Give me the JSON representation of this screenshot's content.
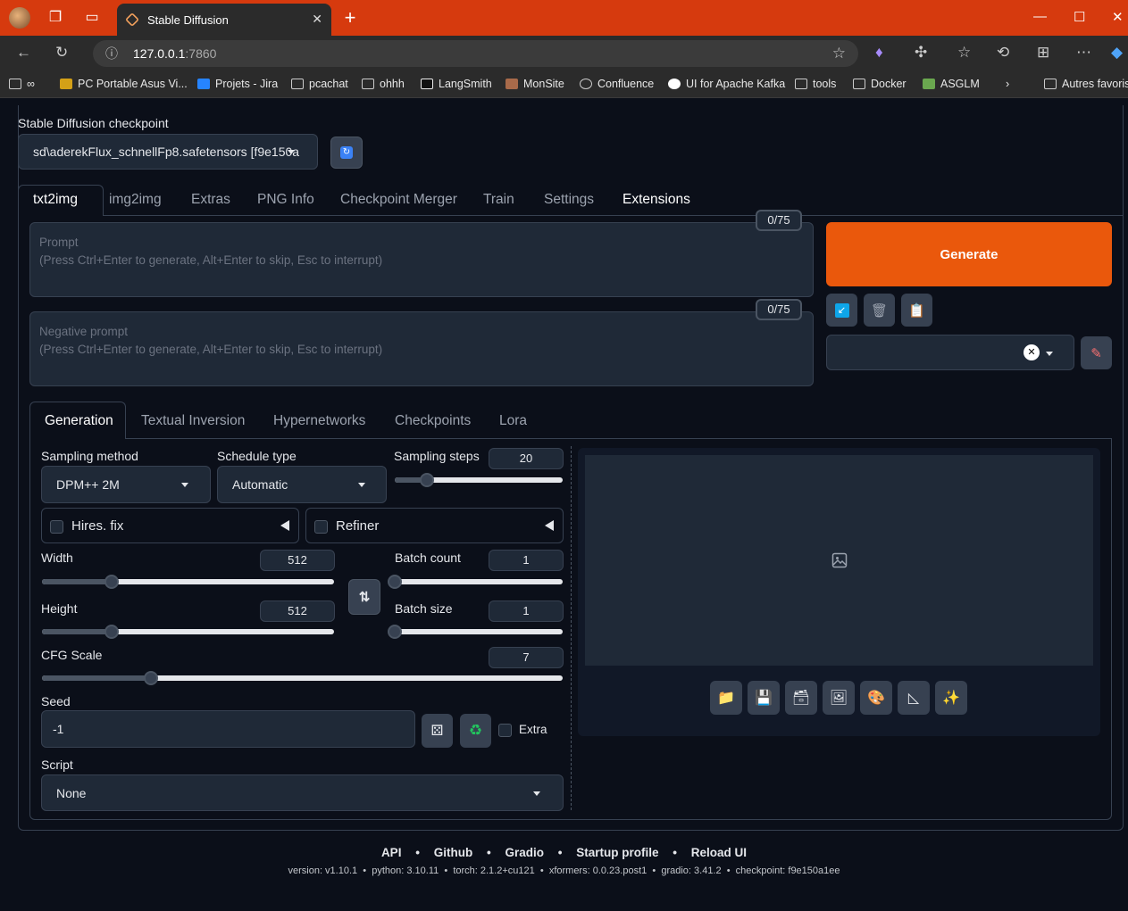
{
  "browser": {
    "tab_title": "Stable Diffusion",
    "url_host": "127.0.0.1",
    "url_port": ":7860",
    "bookmarks": [
      "PC Portable Asus Vi...",
      "Projets - Jira",
      "pcachat",
      "ohhh",
      "LangSmith",
      "MonSite",
      "Confluence",
      "UI for Apache Kafka",
      "tools",
      "Docker",
      "ASGLM",
      "Autres favoris"
    ]
  },
  "checkpoint": {
    "label": "Stable Diffusion checkpoint",
    "value": "sd\\aderekFlux_schnellFp8.safetensors [f9e150a"
  },
  "main_tabs": [
    "txt2img",
    "img2img",
    "Extras",
    "PNG Info",
    "Checkpoint Merger",
    "Train",
    "Settings",
    "Extensions"
  ],
  "prompt": {
    "label": "Prompt",
    "hint": "(Press Ctrl+Enter to generate, Alt+Enter to skip, Esc to interrupt)",
    "counter": "0/75"
  },
  "negative_prompt": {
    "label": "Negative prompt",
    "hint": "(Press Ctrl+Enter to generate, Alt+Enter to skip, Esc to interrupt)",
    "counter": "0/75"
  },
  "generate_label": "Generate",
  "sub_tabs": [
    "Generation",
    "Textual Inversion",
    "Hypernetworks",
    "Checkpoints",
    "Lora"
  ],
  "sampling_method": {
    "label": "Sampling method",
    "value": "DPM++ 2M"
  },
  "schedule_type": {
    "label": "Schedule type",
    "value": "Automatic"
  },
  "sampling_steps": {
    "label": "Sampling steps",
    "value": "20",
    "fraction": 0.19
  },
  "hires_fix": "Hires. fix",
  "refiner": "Refiner",
  "width": {
    "label": "Width",
    "value": "512",
    "fraction": 0.24
  },
  "height": {
    "label": "Height",
    "value": "512",
    "fraction": 0.24
  },
  "batch_count": {
    "label": "Batch count",
    "value": "1",
    "fraction": 0
  },
  "batch_size": {
    "label": "Batch size",
    "value": "1",
    "fraction": 0
  },
  "cfg_scale": {
    "label": "CFG Scale",
    "value": "7",
    "fraction": 0.21
  },
  "seed": {
    "label": "Seed",
    "value": "-1",
    "extra": "Extra"
  },
  "script": {
    "label": "Script",
    "value": "None"
  },
  "footer": {
    "links": [
      "API",
      "Github",
      "Gradio",
      "Startup profile",
      "Reload UI"
    ],
    "separator": "•",
    "version": "version: v1.10.1  •  python: 3.10.11  •  torch: 2.1.2+cu121  •  xformers: 0.0.23.post1  •  gradio: 3.41.2  •  checkpoint: f9e150a1ee"
  }
}
